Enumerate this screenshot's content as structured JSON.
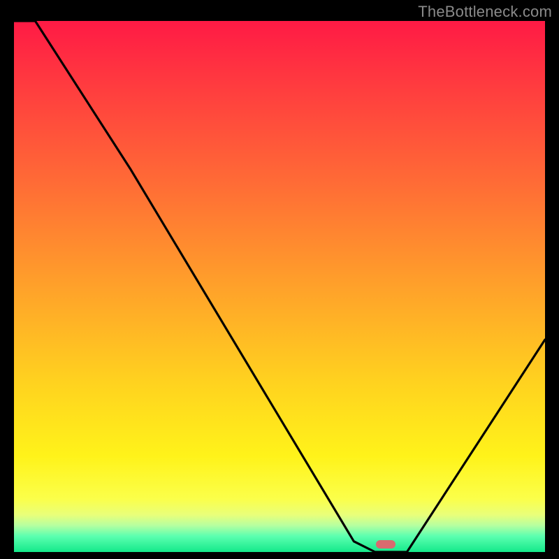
{
  "watermark": "TheBottleneck.com",
  "chart_data": {
    "type": "line",
    "title": "",
    "xlabel": "",
    "ylabel": "",
    "xlim": [
      0,
      100
    ],
    "ylim": [
      0,
      100
    ],
    "series": [
      {
        "name": "curve",
        "x": [
          0,
          4,
          22,
          64,
          68,
          74,
          100
        ],
        "y": [
          100,
          100,
          72,
          2,
          0,
          0,
          40
        ]
      }
    ],
    "marker": {
      "x": 70,
      "y": 1.5
    },
    "colors": {
      "curve": "#000000",
      "marker": "#d96a6f",
      "gradient_top": "#ff1a45",
      "gradient_bottom": "#14e98a"
    }
  }
}
